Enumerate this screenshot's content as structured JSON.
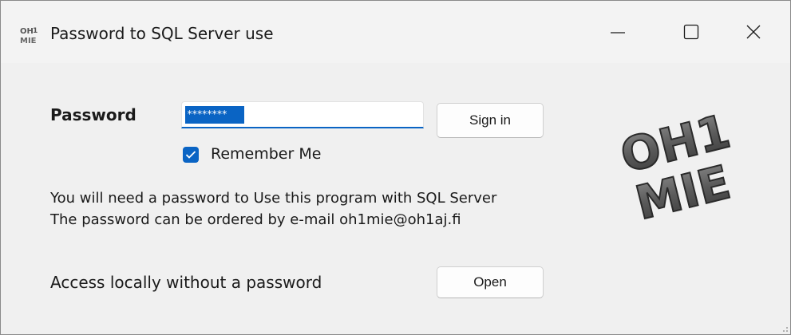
{
  "window": {
    "title": "Password to SQL Server use",
    "app_icon": "oh1-mie-icon",
    "controls": [
      "minimize-icon",
      "maximize-icon",
      "close-icon"
    ]
  },
  "form": {
    "password_label": "Password",
    "password_value": "********",
    "sign_in_label": "Sign in",
    "remember_label": "Remember Me",
    "remember_checked": true,
    "info_line_1": "You will need a password to Use this program with SQL Server",
    "info_line_2": "The password can be ordered by e-mail oh1mie@oh1aj.fi",
    "access_label": "Access locally without a password",
    "open_label": "Open"
  },
  "logo": {
    "line_1": "OH1",
    "line_2": "MIE"
  },
  "colors": {
    "accent": "#0a64c4",
    "window_bg": "#f0f0f0"
  }
}
